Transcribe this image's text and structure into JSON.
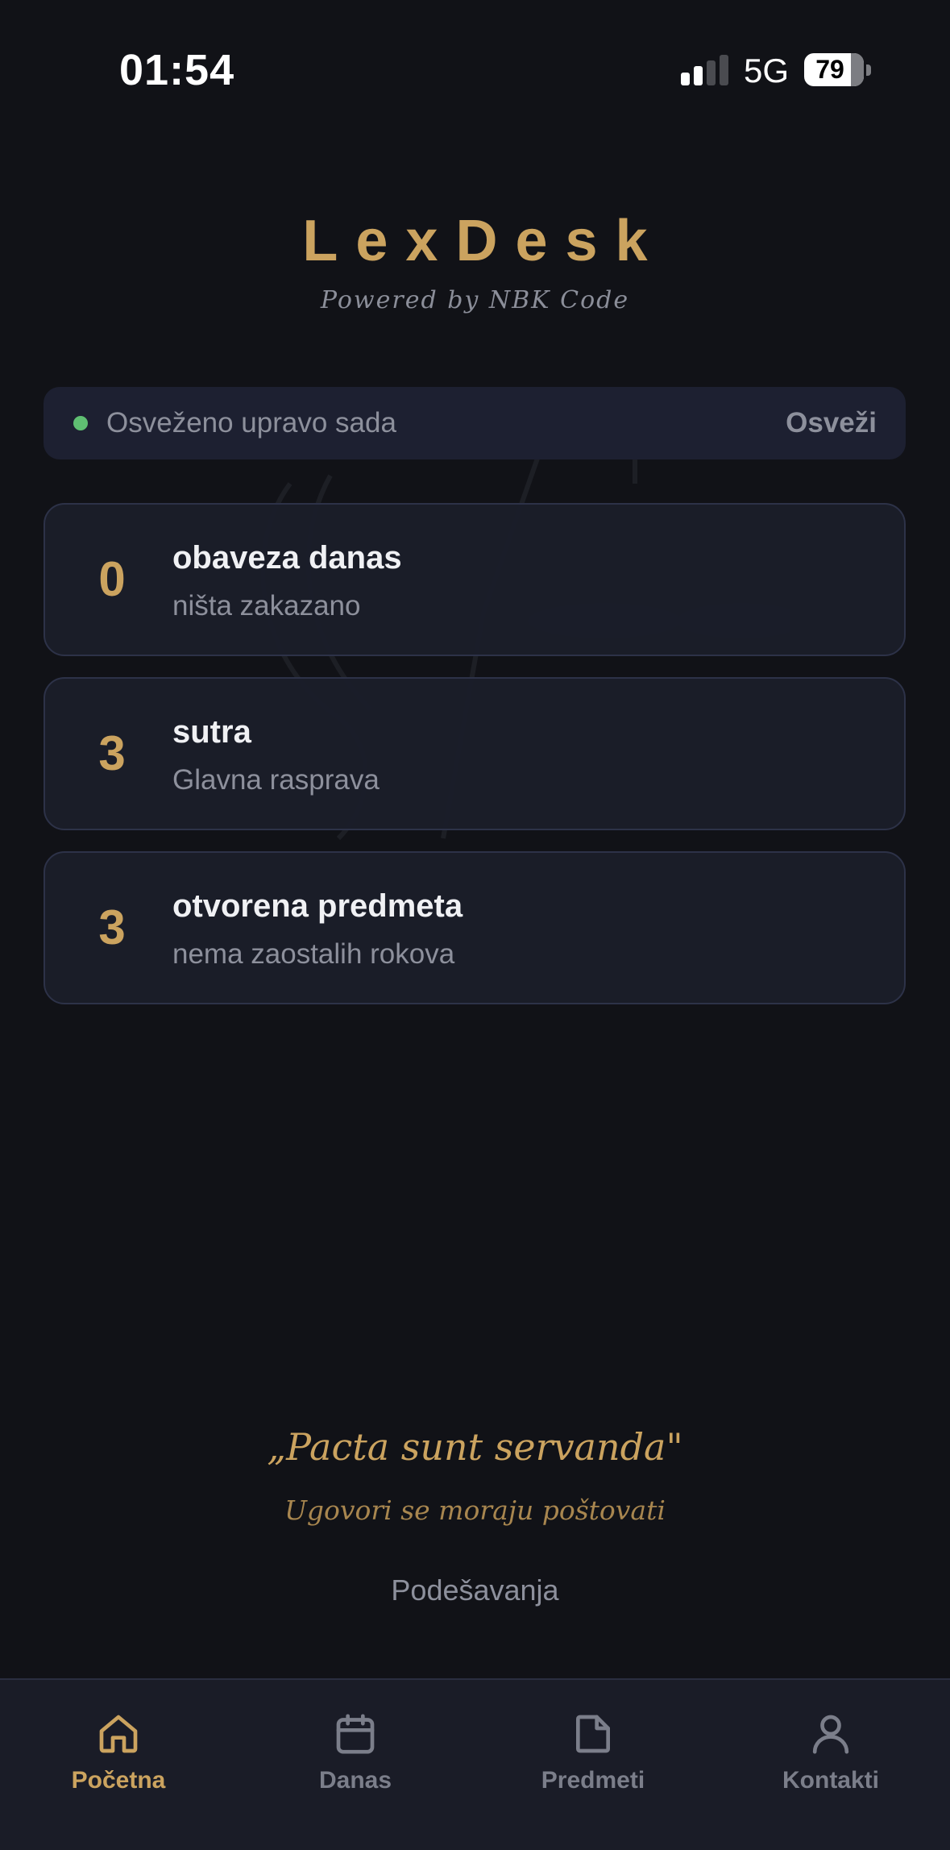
{
  "status_bar": {
    "time": "01:54",
    "network": "5G",
    "battery": "79",
    "battery_level": 0.79
  },
  "header": {
    "title": "LexDesk",
    "subtitle": "Powered by NBK Code"
  },
  "refresh": {
    "status": "Osveženo upravo sada",
    "button_label": "Osveži",
    "indicator_color": "#5fbf72"
  },
  "cards": [
    {
      "count": "0",
      "title": "obaveza danas",
      "subtitle": "ništa zakazano"
    },
    {
      "count": "3",
      "title": "sutra",
      "subtitle": "Glavna rasprava"
    },
    {
      "count": "3",
      "title": "otvorena predmeta",
      "subtitle": "nema zaostalih rokova"
    }
  ],
  "quote": {
    "text": "„Pacta sunt servanda\"",
    "translation": "Ugovori se moraju poštovati"
  },
  "settings_label": "Podešavanja",
  "nav": {
    "active": "Početna",
    "items": [
      {
        "label": "Početna",
        "icon": "home-icon"
      },
      {
        "label": "Danas",
        "icon": "calendar-icon"
      },
      {
        "label": "Predmeti",
        "icon": "document-icon"
      },
      {
        "label": "Kontakti",
        "icon": "person-icon"
      }
    ]
  },
  "colors": {
    "background": "#111217",
    "accent": "#cba35f",
    "card_background": "#1b1e29",
    "card_border": "#2d3248",
    "muted_text": "#8d909c",
    "nav_inactive": "#7b7e8a"
  }
}
